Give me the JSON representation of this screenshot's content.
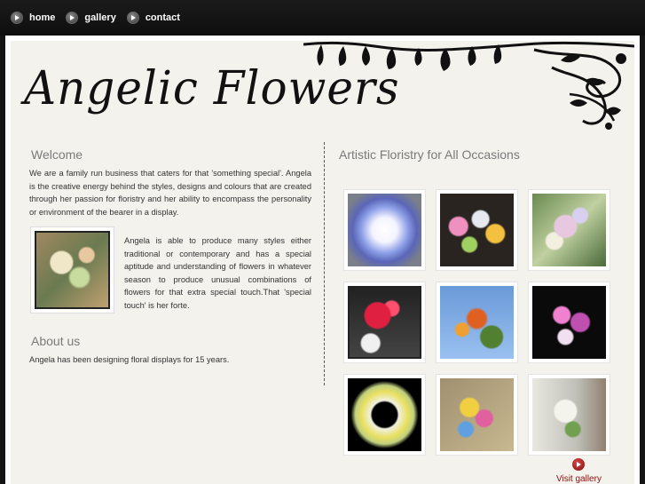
{
  "nav": {
    "items": [
      {
        "label": "home",
        "icon": "arrow-right-icon"
      },
      {
        "label": "gallery",
        "icon": "arrow-right-icon"
      },
      {
        "label": "contact",
        "icon": "arrow-right-icon"
      }
    ]
  },
  "header": {
    "logo_text": "Angelic Flowers"
  },
  "welcome": {
    "title": "Welcome",
    "text": "We are a family run business that caters for that 'something special'. Angela is the creative energy behind the styles, designs and colours that are created through her passion for floristry and her ability to encompass the personality or environment of the bearer in a display.",
    "side_text": "Angela is able to produce many styles either traditional or contemporary and has a special aptitude and understanding of flowers in whatever season to produce unusual combinations of flowers for that extra special touch.That 'special touch' is her forte."
  },
  "about": {
    "title": "About us",
    "text": "Angela has been designing floral displays for 15 years."
  },
  "gallery": {
    "title": "Artistic Floristry for All Occasions",
    "visit_label": "Visit gallery"
  },
  "colors": {
    "accent_red": "#8a1010",
    "divider": "#aa3333",
    "background": "#f3f2ec"
  }
}
